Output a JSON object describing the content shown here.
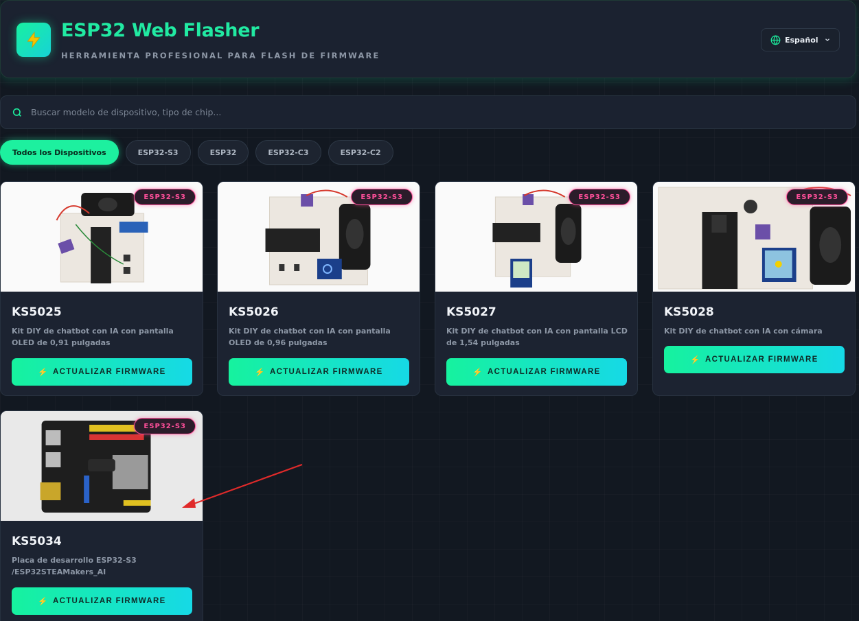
{
  "header": {
    "title": "ESP32 Web Flasher",
    "subtitle": "HERRAMIENTA PROFESIONAL PARA FLASH DE FIRMWARE",
    "logo_icon": "lightning-bolt-icon",
    "language": "Español"
  },
  "search": {
    "placeholder": "Buscar modelo de dispositivo, tipo de chip..."
  },
  "filters": [
    {
      "label": "Todos los Dispositivos",
      "active": true
    },
    {
      "label": "ESP32-S3",
      "active": false
    },
    {
      "label": "ESP32",
      "active": false
    },
    {
      "label": "ESP32-C3",
      "active": false
    },
    {
      "label": "ESP32-C2",
      "active": false
    }
  ],
  "cards": [
    {
      "badge": "ESP32-S3",
      "model": "KS5025",
      "description": "Kit DIY de chatbot con IA con pantalla OLED de 0,91 pulgadas",
      "button": "ACTUALIZAR FIRMWARE"
    },
    {
      "badge": "ESP32-S3",
      "model": "KS5026",
      "description": "Kit DIY de chatbot con IA con pantalla OLED de 0,96 pulgadas",
      "button": "ACTUALIZAR FIRMWARE"
    },
    {
      "badge": "ESP32-S3",
      "model": "KS5027",
      "description": "Kit DIY de chatbot con IA con pantalla LCD de 1,54 pulgadas",
      "button": "ACTUALIZAR FIRMWARE"
    },
    {
      "badge": "ESP32-S3",
      "model": "KS5028",
      "description": "Kit DIY de chatbot con IA con cámara",
      "button": "ACTUALIZAR FIRMWARE"
    },
    {
      "badge": "ESP32-S3",
      "model": "KS5034",
      "description": "Placa de desarrollo ESP32-S3 /ESP32STEAMakers_AI",
      "button": "ACTUALIZAR FIRMWARE"
    }
  ],
  "colors": {
    "accent": "#1df09f",
    "accent_cyan": "#16d9e6",
    "badge": "#ff4f9a",
    "background": "#121821",
    "card": "#1c2331"
  }
}
